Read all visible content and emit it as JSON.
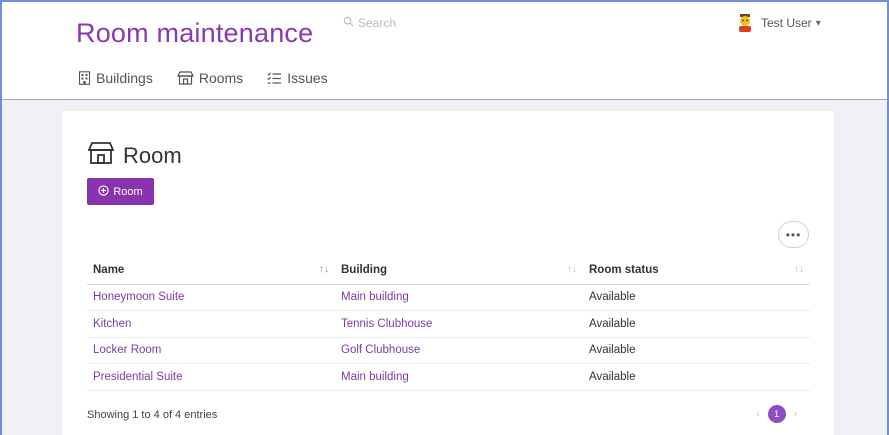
{
  "header": {
    "brand": "Room maintenance",
    "search_placeholder": "Search",
    "user_name": "Test User",
    "user_caret": "▾"
  },
  "nav": {
    "items": [
      {
        "label": "Buildings",
        "icon": "building-icon"
      },
      {
        "label": "Rooms",
        "icon": "room-icon"
      },
      {
        "label": "Issues",
        "icon": "issues-list-icon"
      }
    ]
  },
  "page": {
    "title": "Room",
    "add_button_label": "Room",
    "more_button_label": "•••"
  },
  "table": {
    "columns": [
      "Name",
      "Building",
      "Room status"
    ],
    "rows": [
      {
        "name": "Honeymoon Suite",
        "building": "Main building",
        "status": "Available"
      },
      {
        "name": "Kitchen",
        "building": "Tennis Clubhouse",
        "status": "Available"
      },
      {
        "name": "Locker Room",
        "building": "Golf Clubhouse",
        "status": "Available"
      },
      {
        "name": "Presidential Suite",
        "building": "Main building",
        "status": "Available"
      }
    ]
  },
  "footer": {
    "info": "Showing 1 to 4 of 4 entries",
    "prev": "‹",
    "current_page": "1",
    "next": "›"
  },
  "colors": {
    "accent": "#8a33ae",
    "link": "#7d3aa6",
    "frame": "#6f8fd8"
  }
}
